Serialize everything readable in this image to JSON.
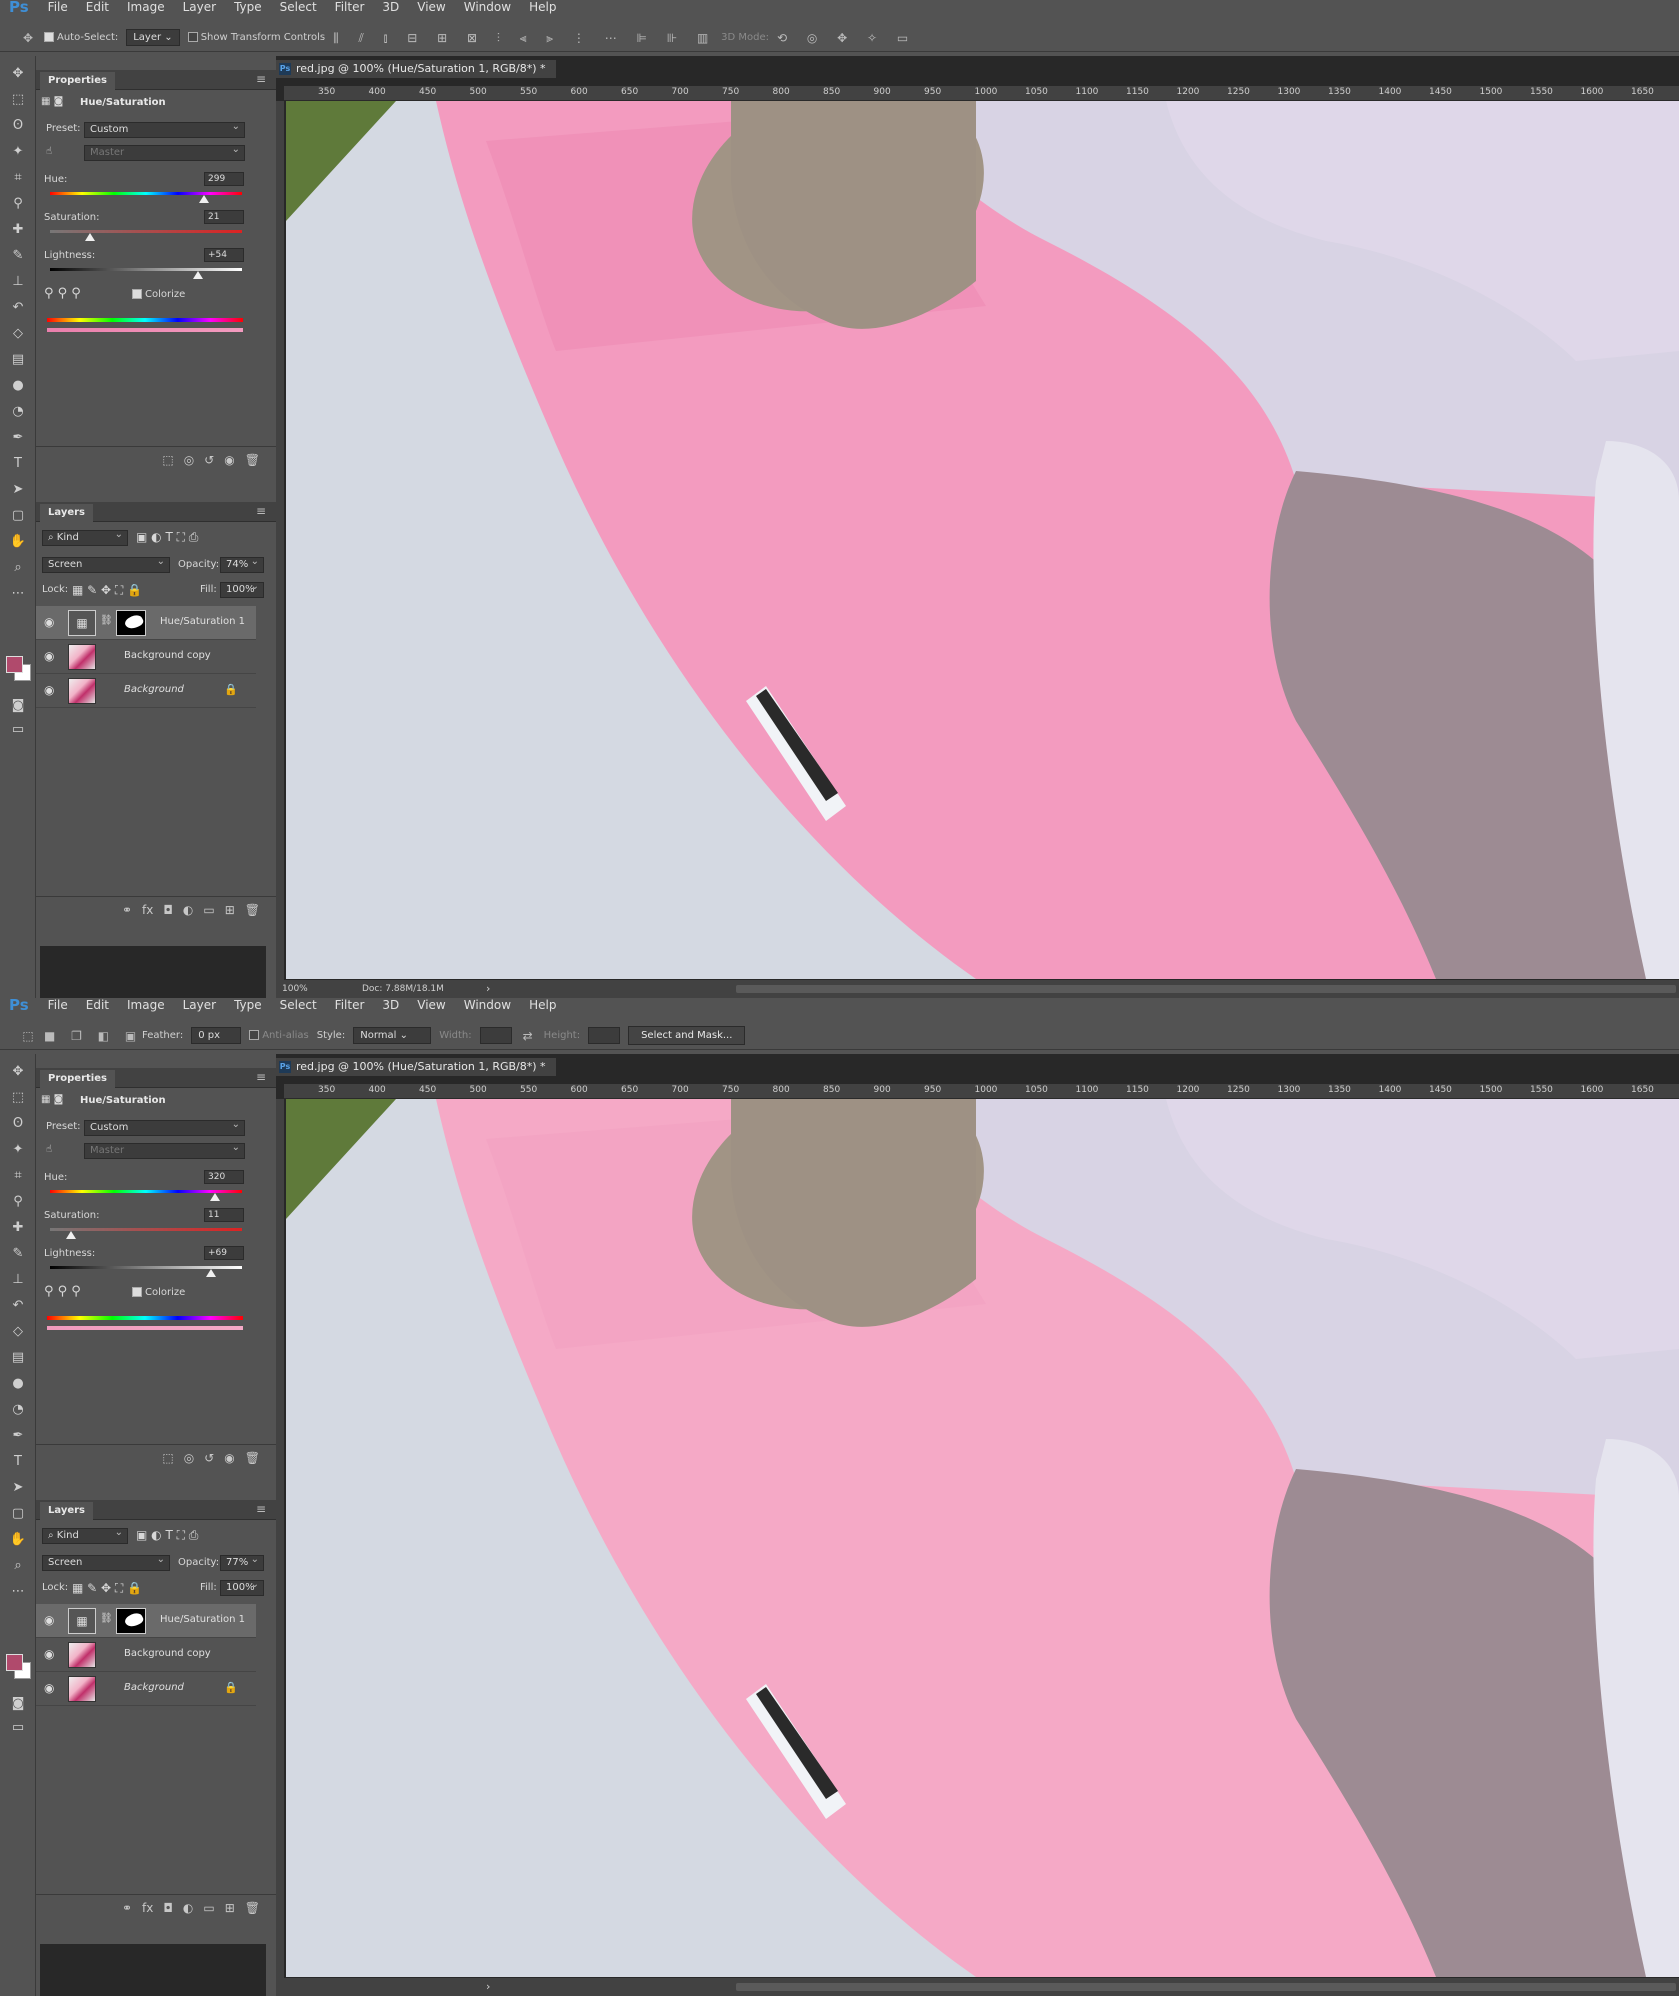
{
  "app": {
    "logo": "Ps"
  },
  "menu": [
    "File",
    "Edit",
    "Image",
    "Layer",
    "Type",
    "Select",
    "Filter",
    "3D",
    "View",
    "Window",
    "Help"
  ],
  "shots": [
    {
      "options": {
        "kind": "move",
        "auto_select_label": "Auto-Select:",
        "auto_select_target": "Layer",
        "show_transform": "Show Transform Controls",
        "mode_3d": "3D Mode:"
      },
      "doc_tab": "red.jpg @ 100% (Hue/Saturation 1, RGB/8*) *",
      "properties": {
        "tab": "Properties",
        "title": "Hue/Saturation",
        "preset_label": "Preset:",
        "preset_value": "Custom",
        "channel": "Master",
        "hue_label": "Hue:",
        "hue": "299",
        "hue_pos": 0.8,
        "sat_label": "Saturation:",
        "sat": "21",
        "sat_pos": 0.21,
        "light_label": "Lightness:",
        "light": "+54",
        "light_pos": 0.77,
        "colorize": "Colorize"
      },
      "layers": {
        "tab": "Layers",
        "kind": "Kind",
        "blend": "Screen",
        "opacity_label": "Opacity:",
        "opacity": "74%",
        "lock_label": "Lock:",
        "fill_label": "Fill:",
        "fill": "100%",
        "items": [
          "Hue/Saturation 1",
          "Background copy",
          "Background"
        ]
      },
      "status": {
        "zoom": "100%",
        "doc": "Doc: 7.88M/18.1M"
      },
      "pink": "#f39bbf",
      "pink_dark": "#ea7fac"
    },
    {
      "options": {
        "kind": "marquee",
        "feather_label": "Feather:",
        "feather": "0 px",
        "antialias": "Anti-alias",
        "style_label": "Style:",
        "style": "Normal",
        "width_label": "Width:",
        "height_label": "Height:",
        "mask_button": "Select and Mask..."
      },
      "doc_tab": "red.jpg @ 100% (Hue/Saturation 1, RGB/8*) *",
      "properties": {
        "tab": "Properties",
        "title": "Hue/Saturation",
        "preset_label": "Preset:",
        "preset_value": "Custom",
        "channel": "Master",
        "hue_label": "Hue:",
        "hue": "320",
        "hue_pos": 0.86,
        "sat_label": "Saturation:",
        "sat": "11",
        "sat_pos": 0.11,
        "light_label": "Lightness:",
        "light": "+69",
        "light_pos": 0.84,
        "colorize": "Colorize"
      },
      "layers": {
        "tab": "Layers",
        "kind": "Kind",
        "blend": "Screen",
        "opacity_label": "Opacity:",
        "opacity": "77%",
        "lock_label": "Lock:",
        "fill_label": "Fill:",
        "fill": "100%",
        "items": [
          "Hue/Saturation 1",
          "Background copy",
          "Background"
        ]
      },
      "status": {
        "zoom": "",
        "doc": ""
      },
      "pink": "#f5a9c6",
      "pink_dark": "#f09abd"
    }
  ],
  "ruler_ticks": [
    "350",
    "400",
    "450",
    "500",
    "550",
    "600",
    "650",
    "700",
    "750",
    "800",
    "850",
    "900",
    "950",
    "1000",
    "1050",
    "1100",
    "1150",
    "1200",
    "1250",
    "1300",
    "1350",
    "1400",
    "1450",
    "1500",
    "1550",
    "1600",
    "1650"
  ]
}
